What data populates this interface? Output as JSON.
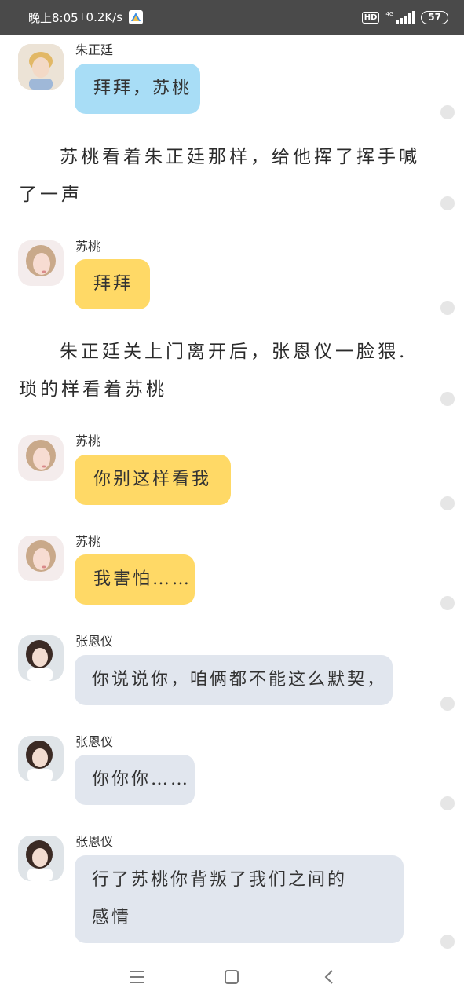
{
  "status_bar": {
    "time": "晚上8:05",
    "separator": "I",
    "speed": "0.2K/s",
    "hd": "HD",
    "network": "4G",
    "battery": "57"
  },
  "messages": [
    {
      "speaker": "朱正廷",
      "text": "拜拜，苏桃",
      "style": "blue"
    },
    {
      "narration": "苏桃看着朱正廷那样，给他挥了挥手喊了一声"
    },
    {
      "speaker": "苏桃",
      "text": "拜拜",
      "style": "yellow"
    },
    {
      "narration": "朱正廷关上门离开后，张恩仪一脸猥.琐的样看着苏桃"
    },
    {
      "speaker": "苏桃",
      "text": "你别这样看我",
      "style": "yellow"
    },
    {
      "speaker": "苏桃",
      "text": "我害怕……",
      "style": "yellow"
    },
    {
      "speaker": "张恩仪",
      "text": "你说说你，咱俩都不能这么默契，",
      "style": "gray"
    },
    {
      "speaker": "张恩仪",
      "text": "你你你……",
      "style": "gray"
    },
    {
      "speaker": "张恩仪",
      "text": "行了苏桃你背叛了我们之间的感情",
      "style": "gray"
    }
  ],
  "colors": {
    "blue_bubble": "#a8ddf6",
    "yellow_bubble": "#ffd966",
    "gray_bubble": "#e1e6ee",
    "status_bar": "#4a4a4a"
  },
  "icons": {
    "nav_menu": "menu-icon",
    "nav_home": "home-icon",
    "nav_back": "back-icon"
  }
}
